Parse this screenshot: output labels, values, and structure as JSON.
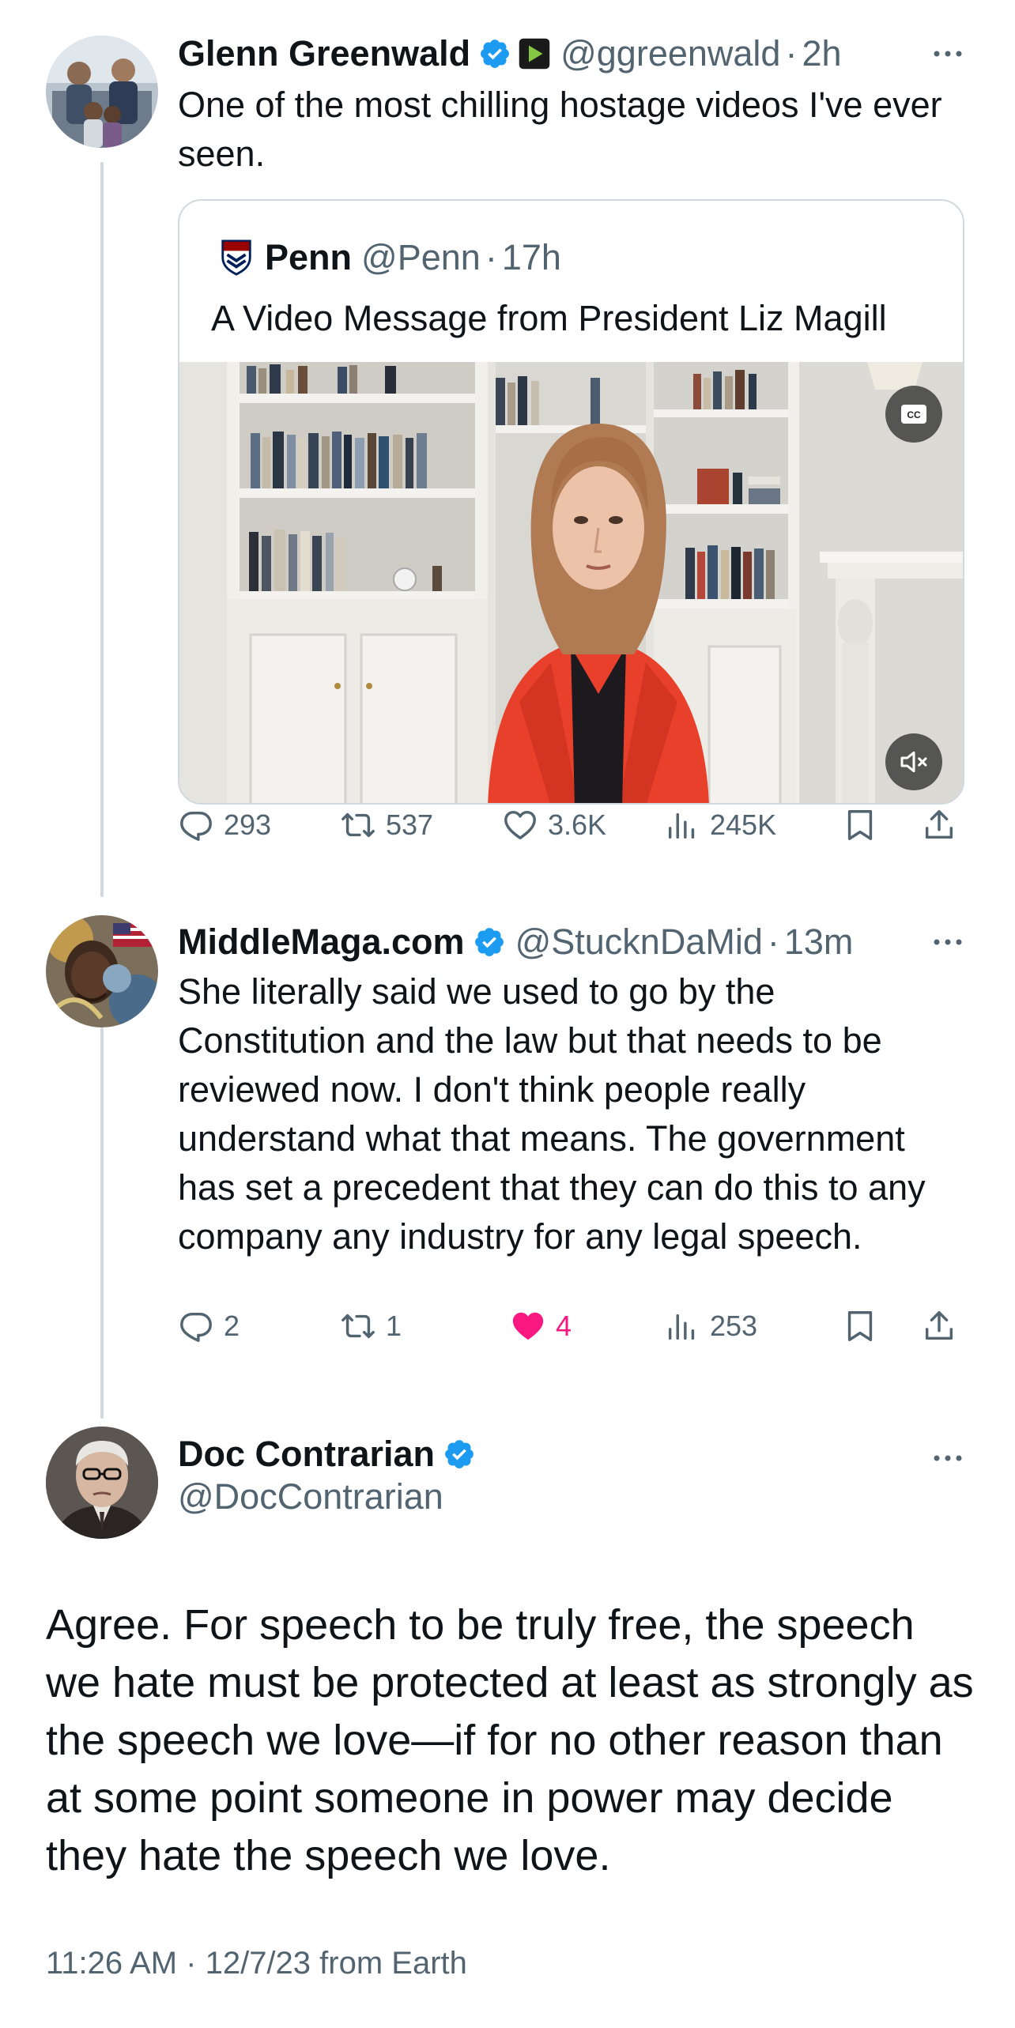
{
  "colors": {
    "verified": "#1d9bf0",
    "liked": "#f91880",
    "secondary_text": "#536471",
    "thread_line": "#cfd9de"
  },
  "tweet1": {
    "author_name": "Glenn Greenwald",
    "handle": "@ggreenwald",
    "dot": "·",
    "time": "2h",
    "text": "One of the most chilling hostage videos I've ever seen.",
    "icons": [
      "verified-badge-icon",
      "rumble-affiliate-icon",
      "more-icon"
    ],
    "quote": {
      "author_name": "Penn",
      "handle": "@Penn",
      "dot": "·",
      "time": "17h",
      "text": "A Video Message from President Liz Magill",
      "cc_label": "CC",
      "icons": [
        "penn-shield-icon",
        "closed-captions-icon",
        "mute-icon"
      ]
    },
    "stats": {
      "replies": "293",
      "reposts": "537",
      "likes": "3.6K",
      "views": "245K"
    }
  },
  "tweet2": {
    "author_name": "MiddleMaga.com",
    "handle": "@StucknDaMid",
    "dot": "·",
    "time": "13m",
    "text": "She literally said we used to go by the Constitution and the law but that needs to be reviewed now. I don't think people really understand what that means. The government has set a precedent that they can do this to any company any industry for any legal speech.",
    "stats": {
      "replies": "2",
      "reposts": "1",
      "likes": "4",
      "views": "253"
    },
    "liked": true
  },
  "main_tweet": {
    "author_name": "Doc Contrarian",
    "handle": "@DocContrarian",
    "text": "Agree. For speech to be truly free, the speech we hate must be protected at least as strongly as the speech we love—if for no other reason than at some point someone in power may decide they hate the speech we love.",
    "timestamp": "11:26 AM · 12/7/23 from Earth"
  }
}
